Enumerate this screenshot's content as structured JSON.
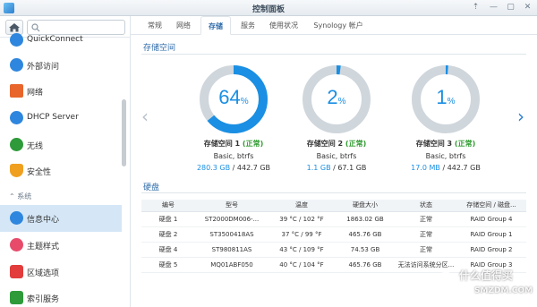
{
  "window": {
    "title": "控制面板"
  },
  "sidebar": {
    "search_placeholder": "",
    "items": [
      {
        "label": "QuickConnect",
        "icon": "quickconnect-icon",
        "color": "#2e86de"
      },
      {
        "label": "外部访问",
        "icon": "globe-icon",
        "color": "#2e86de"
      },
      {
        "label": "网络",
        "icon": "network-icon",
        "color": "#e8652b"
      },
      {
        "label": "DHCP Server",
        "icon": "dhcp-icon",
        "color": "#2e86de"
      },
      {
        "label": "无线",
        "icon": "wifi-icon",
        "color": "#2e9a3a"
      },
      {
        "label": "安全性",
        "icon": "shield-icon",
        "color": "#f0a020"
      },
      {
        "label": "信息中心",
        "icon": "info-icon",
        "color": "#2e86de"
      },
      {
        "label": "主题样式",
        "icon": "palette-icon",
        "color": "#e84b6a"
      },
      {
        "label": "区域选项",
        "icon": "region-icon",
        "color": "#e23c3c"
      },
      {
        "label": "索引服务",
        "icon": "index-icon",
        "color": "#2e9a3a"
      }
    ],
    "section_system": "系统"
  },
  "tabs": [
    {
      "label": "常规"
    },
    {
      "label": "网络"
    },
    {
      "label": "存储"
    },
    {
      "label": "服务"
    },
    {
      "label": "使用状况"
    },
    {
      "label": "Synology 帐户"
    }
  ],
  "storage": {
    "heading": "存储空间",
    "volumes": [
      {
        "percent": 64,
        "percent_number": "64",
        "name": "存储空间 1",
        "status": "(正常)",
        "fs": "Basic, btrfs",
        "used": "280.3 GB",
        "total": " / 442.7 GB"
      },
      {
        "percent": 2,
        "percent_number": "2",
        "name": "存储空间 2",
        "status": "(正常)",
        "fs": "Basic, btrfs",
        "used": "1.1 GB",
        "total": " / 67.1 GB"
      },
      {
        "percent": 1,
        "percent_number": "1",
        "name": "存储空间 3",
        "status": "(正常)",
        "fs": "Basic, btrfs",
        "used": "17.0 MB",
        "total": " / 442.7 GB"
      }
    ],
    "percent_sign": "%"
  },
  "disks": {
    "heading": "硬盘",
    "columns": [
      "编号",
      "型号",
      "温度",
      "硬盘大小",
      "状态",
      "存储空间 / 磁盘..."
    ],
    "rows": [
      {
        "id": "硬盘 1",
        "model": "ST2000DM006-...",
        "temp": "39 °C / 102 °F",
        "size": "1863.02 GB",
        "status": "正常",
        "status_kind": "ok",
        "group": "RAID Group 4"
      },
      {
        "id": "硬盘 2",
        "model": "ST3500418AS",
        "temp": "37 °C / 99 °F",
        "size": "465.76 GB",
        "status": "正常",
        "status_kind": "ok",
        "group": "RAID Group 1"
      },
      {
        "id": "硬盘 4",
        "model": "ST980811AS",
        "temp": "43 °C / 109 °F",
        "size": "74.53 GB",
        "status": "正常",
        "status_kind": "ok",
        "group": "RAID Group 2"
      },
      {
        "id": "硬盘 5",
        "model": "MQ01ABF050",
        "temp": "40 °C / 104 °F",
        "size": "465.76 GB",
        "status": "无法访问系统分区...",
        "status_kind": "warn",
        "group": "RAID Group 3"
      }
    ]
  },
  "watermark": {
    "text": "什么值得买",
    "sub": "SMZDM.COM"
  },
  "colors": {
    "accent": "#1a8fe3",
    "ring_bg": "#cfd6dc",
    "ok": "#2f9a2f",
    "warn": "#e23c3c"
  }
}
